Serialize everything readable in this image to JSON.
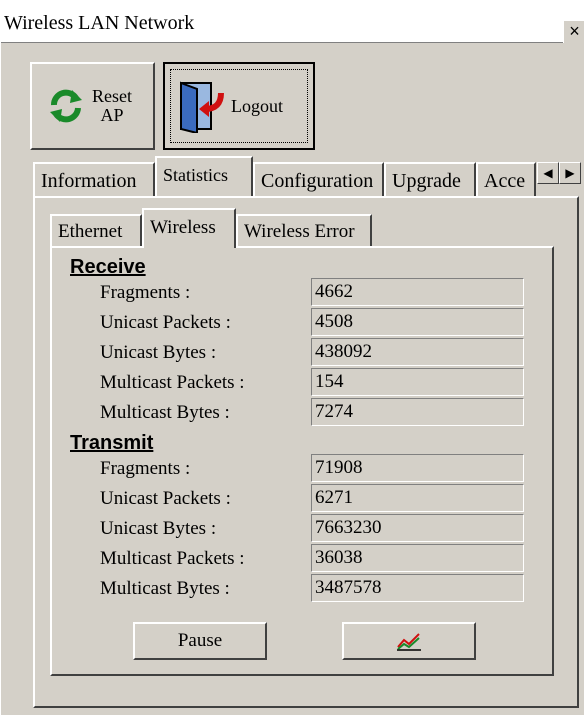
{
  "window": {
    "title": "Wireless LAN Network",
    "close_glyph": "×"
  },
  "toolbar": {
    "reset_label_line1": "Reset",
    "reset_label_line2": "AP",
    "reset_icon": "refresh-icon",
    "logout_label": "Logout",
    "logout_icon": "door-exit-icon"
  },
  "tabs": [
    {
      "label": "Information",
      "active": false
    },
    {
      "label": "Statistics",
      "active": true
    },
    {
      "label": "Configuration",
      "active": false
    },
    {
      "label": "Upgrade",
      "active": false
    },
    {
      "label": "Acce",
      "active": false
    }
  ],
  "tab_scroll": {
    "left": "◀",
    "right": "▶"
  },
  "subtabs": [
    {
      "label": "Ethernet",
      "active": false
    },
    {
      "label": "Wireless",
      "active": true
    },
    {
      "label": "Wireless Error",
      "active": false
    }
  ],
  "receive": {
    "heading": "Receive",
    "rows": [
      {
        "label": "Fragments :",
        "value": "4662"
      },
      {
        "label": "Unicast Packets :",
        "value": "4508"
      },
      {
        "label": "Unicast Bytes :",
        "value": "438092"
      },
      {
        "label": "Multicast Packets :",
        "value": "154"
      },
      {
        "label": "Multicast Bytes :",
        "value": "7274"
      }
    ]
  },
  "transmit": {
    "heading": "Transmit",
    "rows": [
      {
        "label": "Fragments :",
        "value": "71908"
      },
      {
        "label": "Unicast Packets :",
        "value": "6271"
      },
      {
        "label": "Unicast Bytes :",
        "value": "7663230"
      },
      {
        "label": "Multicast Packets :",
        "value": "36038"
      },
      {
        "label": "Multicast Bytes :",
        "value": "3487578"
      }
    ]
  },
  "actions": {
    "pause_label": "Pause",
    "chart_icon": "chart-icon"
  }
}
